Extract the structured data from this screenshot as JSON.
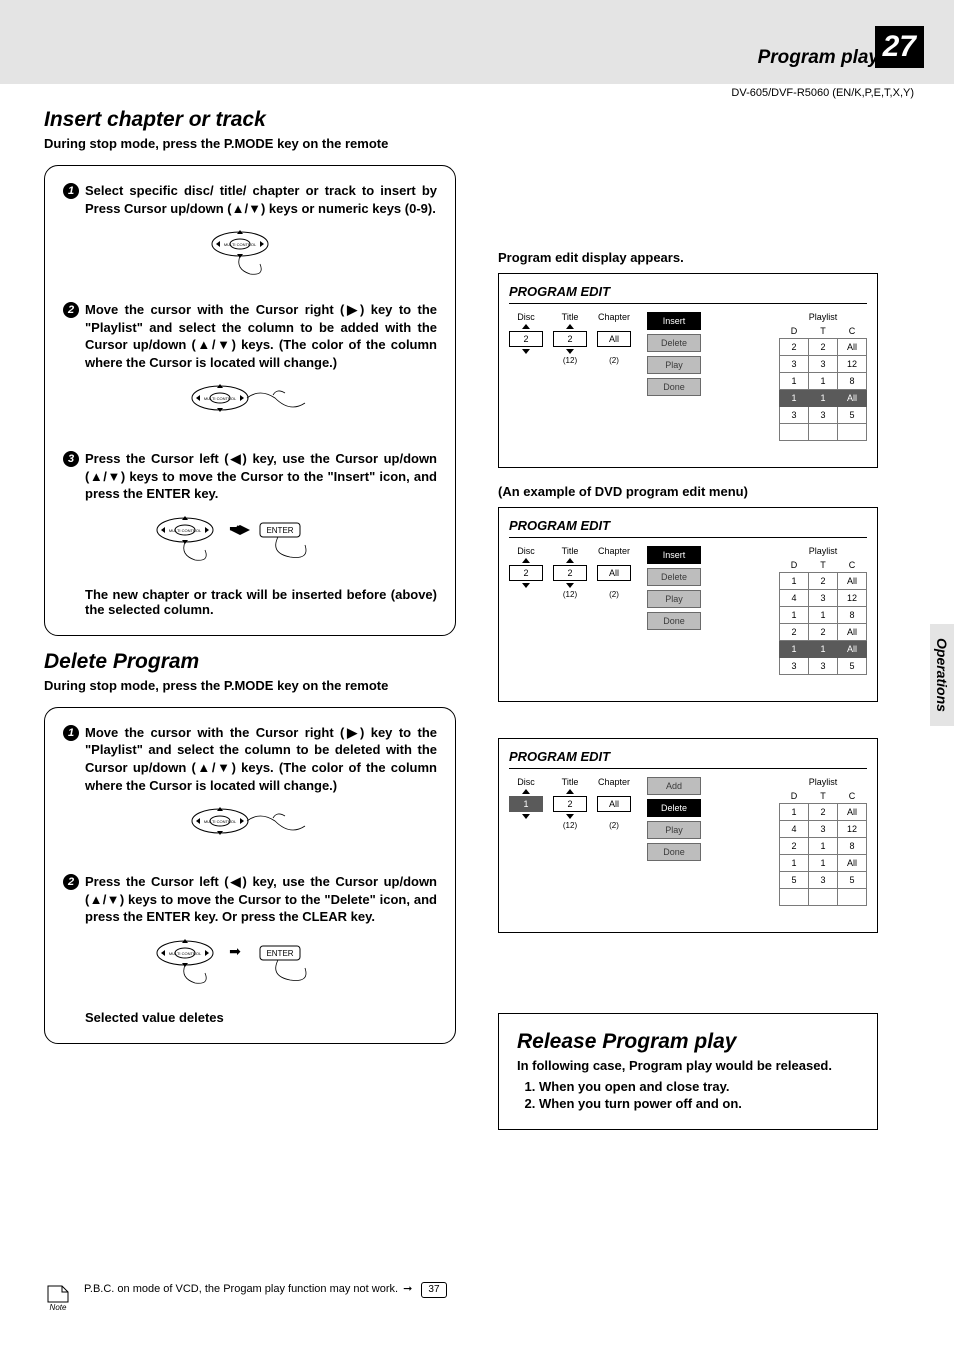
{
  "header": {
    "section": "Program play",
    "page_number": "27",
    "model": "DV-605/DVF-R5060 (EN/K,P,E,T,X,Y)",
    "side_tab": "Operations"
  },
  "insert": {
    "title": "Insert chapter or track",
    "subhead": "During stop mode, press the P.MODE key on the remote",
    "step1": "Select specific disc/ title/ chapter or track to insert by Press Cursor up/down (▲/▼) keys or numeric keys (0-9).",
    "step2": "Move the cursor with the Cursor right (▶) key to the \"Playlist\" and select the column to be added with the Cursor up/down (▲/▼) keys. (The color of the column where the Cursor is located will change.)",
    "step3": "Press the Cursor left (◀) key, use the Cursor up/down (▲/▼) keys to move the Cursor to the \"Insert\" icon, and press the ENTER key.",
    "note": "The new chapter or track will be inserted before (above) the selected column."
  },
  "delete": {
    "title": "Delete Program",
    "subhead": "During stop mode, press the P.MODE key on the remote",
    "step1": "Move the cursor with the Cursor right (▶) key to the \"Playlist\" and select the column to be deleted with the Cursor up/down (▲/▼) keys. (The color of the column where the Cursor is located will change.)",
    "step2": "Press the Cursor left (◀) key, use the Cursor up/down (▲/▼) keys to move the Cursor to the \"Delete\" icon, and press the ENTER key. Or press the CLEAR key.",
    "note": "Selected value deletes"
  },
  "footnote": {
    "text": "P.B.C. on mode of VCD, the Progam play function may not work.",
    "ref": "37"
  },
  "right": {
    "heading1": "Program edit display appears.",
    "heading2": "(An example of DVD program edit menu)",
    "panel_title": "PROGRAM EDIT",
    "labels": {
      "disc": "Disc",
      "title": "Title",
      "chapter": "Chapter",
      "playlist": "Playlist",
      "d": "D",
      "t": "T",
      "c": "C"
    },
    "buttons": {
      "insert": "Insert",
      "delete": "Delete",
      "play": "Play",
      "done": "Done",
      "add": "Add"
    },
    "panel1": {
      "disc": "2",
      "title": "2",
      "chapter": "All",
      "titlesub": "(12)",
      "chsub": "(2)",
      "rows": [
        {
          "d": "2",
          "t": "2",
          "c": "All"
        },
        {
          "d": "3",
          "t": "3",
          "c": "12"
        },
        {
          "d": "1",
          "t": "1",
          "c": "8"
        },
        {
          "d": "1",
          "t": "1",
          "c": "All"
        },
        {
          "d": "3",
          "t": "3",
          "c": "5"
        }
      ],
      "highlight_row": 3,
      "selected_button": "Insert"
    },
    "panel2": {
      "disc": "2",
      "title": "2",
      "chapter": "All",
      "titlesub": "(12)",
      "chsub": "(2)",
      "rows": [
        {
          "d": "1",
          "t": "2",
          "c": "All"
        },
        {
          "d": "4",
          "t": "3",
          "c": "12"
        },
        {
          "d": "1",
          "t": "1",
          "c": "8"
        },
        {
          "d": "2",
          "t": "2",
          "c": "All"
        },
        {
          "d": "1",
          "t": "1",
          "c": "All"
        },
        {
          "d": "3",
          "t": "3",
          "c": "5"
        }
      ],
      "highlight_row": 4,
      "selected_button": "Insert"
    },
    "panel3": {
      "disc": "1",
      "title": "2",
      "chapter": "All",
      "titlesub": "(12)",
      "chsub": "(2)",
      "rows": [
        {
          "d": "1",
          "t": "2",
          "c": "All"
        },
        {
          "d": "4",
          "t": "3",
          "c": "12"
        },
        {
          "d": "2",
          "t": "1",
          "c": "8"
        },
        {
          "d": "1",
          "t": "1",
          "c": "All"
        },
        {
          "d": "5",
          "t": "3",
          "c": "5"
        }
      ],
      "highlight_row": -1,
      "selected_button": "Delete",
      "first_button": "Add"
    }
  },
  "release": {
    "title": "Release Program play",
    "lead": "In following case, Program play would be released.",
    "items": [
      "When you open and close tray.",
      "When you turn power off and on."
    ]
  },
  "icons": {
    "multi": "MULTI CONTROL",
    "enter": "ENTER"
  }
}
